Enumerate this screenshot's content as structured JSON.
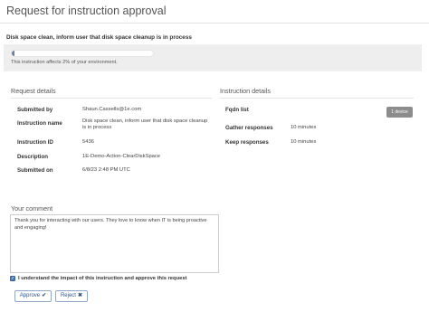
{
  "page": {
    "title": "Request for instruction approval",
    "subtitle": "Disk space clean, inform user that disk space cleanup is in process"
  },
  "environment": {
    "affect_text": "This instruction affects 2% of your environment.",
    "affect_fraction": 0.02
  },
  "request_details": {
    "heading": "Request details",
    "rows": [
      {
        "label": "Submitted by",
        "value": "Shaun.Cassells@1e.com"
      },
      {
        "label": "Instruction name",
        "value": "Disk space clean, inform user that disk space cleanup is in process"
      },
      {
        "label": "Instruction ID",
        "value": "5436"
      },
      {
        "label": "Description",
        "value": "1E-Demo-Action-ClearDiskSpace"
      },
      {
        "label": "Submitted on",
        "value": "6/8/23 2:48 PM UTC"
      }
    ]
  },
  "instruction_details": {
    "heading": "Instruction details",
    "fqdn_label": "Fqdn list",
    "device_badge": "1 device",
    "rows": [
      {
        "label": "Gather responses",
        "value": "10 minutes"
      },
      {
        "label": "Keep responses",
        "value": "10 minutes"
      }
    ]
  },
  "comment": {
    "heading": "Your comment",
    "text": "Thank you for interacting with our users.  They love to know when IT is being proactive and engaging!"
  },
  "confirm": {
    "checked": true,
    "label": "I understand the impact of this instruction and approve this request"
  },
  "actions": {
    "approve_label": "Approve",
    "approve_icon": "check-icon",
    "reject_label": "Reject",
    "reject_icon": "x-icon"
  },
  "colors": {
    "progress_fill": "#6b7f9e",
    "checkbox": "#4a7bb7",
    "button_text": "#2c5a92",
    "badge": "#8c8c8c"
  }
}
